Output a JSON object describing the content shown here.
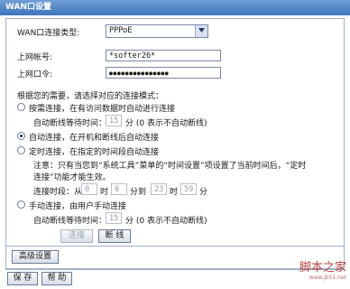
{
  "window": {
    "title": "WAN口设置"
  },
  "form": {
    "conn_type_label": "WAN口连接类型:",
    "conn_type_value": "PPPoE",
    "account_label": "上网帐号:",
    "account_value": "*softer26*",
    "password_label": "上网口令:",
    "password_value": "●●●●●●●●●●●●●●●"
  },
  "modes": {
    "intro": "根据您的需要，请选择对应的连接模式：",
    "on_demand": {
      "label": "按需连接，在有访问数据时自动进行连接",
      "idle_label": "自动断线等待时间：",
      "idle_value": "15",
      "idle_suffix": "分 (0 表示不自动断线)",
      "selected": false
    },
    "auto": {
      "label": "自动连接，在开机和断线后自动连接",
      "selected": true
    },
    "timed": {
      "label": "定时连接，在指定的时间段自动连接",
      "note_line1": "注意：只有当您到“系统工具”菜单的“时间设置”项设置了当前时间后，“定时",
      "note_line2": "连接”功能才能生效。",
      "period_label": "连接时段：从",
      "from_hour": "0",
      "from_hour_unit": "时",
      "from_min": "0",
      "from_min_unit": "分到",
      "to_hour": "23",
      "to_hour_unit": "时",
      "to_min": "59",
      "to_min_unit": "分",
      "selected": false
    },
    "manual": {
      "label": "手动连接，由用户手动连接",
      "idle_label": "自动断线等待时间：",
      "idle_value": "15",
      "idle_suffix": "分 (0 表示不自动断线)",
      "selected": false
    }
  },
  "buttons": {
    "connect": "连接",
    "disconnect": "断 线",
    "advanced": "高级设置",
    "save": "保 存",
    "help": "帮 助"
  },
  "watermark": {
    "main": "脚本之家",
    "sub": "www.jb51.net"
  }
}
